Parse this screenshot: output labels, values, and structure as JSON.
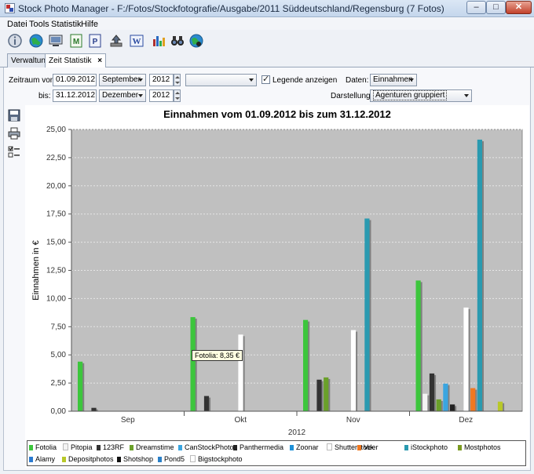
{
  "window": {
    "title": "Stock Photo Manager - F:/Fotos/Stockfotografie/Ausgabe/2011 Süddeutschland/Regensburg (7 Fotos)",
    "min": "–",
    "max": "□",
    "close": "✕"
  },
  "menu": [
    "Datei",
    "Tools",
    "Statistik",
    "Hilfe"
  ],
  "toolbar": [
    {
      "icon": "info-icon",
      "color": "#5a6b84"
    },
    {
      "icon": "globe-icon",
      "color": "#1b7a3a"
    },
    {
      "icon": "monitor-icon",
      "color": "#3a3f48"
    },
    {
      "icon": "document-m-icon",
      "color": "#2c7a2c"
    },
    {
      "icon": "document-p-icon",
      "color": "#2a3f8c"
    },
    {
      "icon": "upload-icon",
      "color": "#444"
    },
    {
      "icon": "word-icon",
      "color": "#2a4aa0"
    },
    {
      "icon": "bar-chart-icon",
      "color": "#b03030"
    },
    {
      "icon": "binoculars-icon",
      "color": "#222"
    },
    {
      "icon": "globe-binoculars-icon",
      "color": "#1b6a3a"
    }
  ],
  "tabs": {
    "verwaltung": "Verwaltung",
    "zeit_statistik": "Zeit Statistik",
    "close_glyph": "×"
  },
  "filter": {
    "zeitraum_label": "Zeitraum von:",
    "von_date": "01.09.2012",
    "von_month": "September",
    "von_year": "2012",
    "extra_select": "",
    "legende_label": "Legende anzeigen",
    "legende_checked": true,
    "daten_label": "Daten:",
    "daten_value": "Einnahmen",
    "bis_label": "bis:",
    "bis_date": "31.12.2012",
    "bis_month": "Dezember",
    "bis_year": "2012",
    "darstellung_label": "Darstellung:",
    "darstellung_value": "Agenturen gruppiert"
  },
  "side_icons": [
    "save-icon",
    "print-icon",
    "checklist-icon"
  ],
  "tooltip": "Fotolia: 8,35 €",
  "chart_data": {
    "type": "bar",
    "title": "Einnahmen vom 01.09.2012 bis zum 31.12.2012",
    "ylabel": "Einnahmen in €",
    "xlabel": "2012",
    "ylim": [
      0,
      25
    ],
    "yticks": [
      "0,00",
      "2,50",
      "5,00",
      "7,50",
      "10,00",
      "12,50",
      "15,00",
      "17,50",
      "20,00",
      "22,50",
      "25,00"
    ],
    "grid": true,
    "legend_position": "bottom",
    "categories": [
      "Sep",
      "Okt",
      "Nov",
      "Dez"
    ],
    "series": [
      {
        "name": "Fotolia",
        "color": "#3cc63c",
        "values": [
          4.4,
          8.35,
          8.1,
          11.6
        ]
      },
      {
        "name": "Pitopia",
        "color": "#f4f4f4",
        "values": [
          0,
          0,
          0,
          1.55
        ]
      },
      {
        "name": "123RF",
        "color": "#333333",
        "values": [
          0.3,
          1.35,
          2.8,
          3.35
        ]
      },
      {
        "name": "Dreamstime",
        "color": "#6aa02a",
        "values": [
          0,
          0,
          3.0,
          1.05
        ]
      },
      {
        "name": "CanStockPhoto",
        "color": "#3aa5e0",
        "values": [
          0,
          0,
          0,
          2.45
        ]
      },
      {
        "name": "Panthermedia",
        "color": "#222222",
        "values": [
          0,
          0,
          0,
          0.6
        ]
      },
      {
        "name": "Zoonar",
        "color": "#1e90d8",
        "values": [
          0,
          0,
          0,
          0
        ]
      },
      {
        "name": "Shutterstock",
        "color": "#ffffff",
        "values": [
          0,
          6.8,
          7.2,
          9.2
        ]
      },
      {
        "name": "Veer",
        "color": "#f07820",
        "values": [
          0,
          0,
          0,
          2.05
        ]
      },
      {
        "name": "iStockphoto",
        "color": "#2a9ab0",
        "values": [
          0,
          0,
          17.1,
          24.1
        ]
      },
      {
        "name": "Mostphotos",
        "color": "#7a9a20",
        "values": [
          0,
          0,
          0,
          0
        ]
      },
      {
        "name": "Alamy",
        "color": "#2a7ad0",
        "values": [
          0,
          0,
          0,
          0
        ]
      },
      {
        "name": "Depositphotos",
        "color": "#b8c828",
        "values": [
          0,
          0,
          0,
          0.85
        ]
      },
      {
        "name": "Shotshop",
        "color": "#111111",
        "values": [
          0,
          0,
          0,
          0
        ]
      },
      {
        "name": "Pond5",
        "color": "#2a80c8",
        "values": [
          0,
          0,
          0,
          0
        ]
      },
      {
        "name": "Bigstockphoto",
        "color": "#ffffff",
        "values": [
          0,
          0,
          0,
          0
        ]
      }
    ]
  }
}
